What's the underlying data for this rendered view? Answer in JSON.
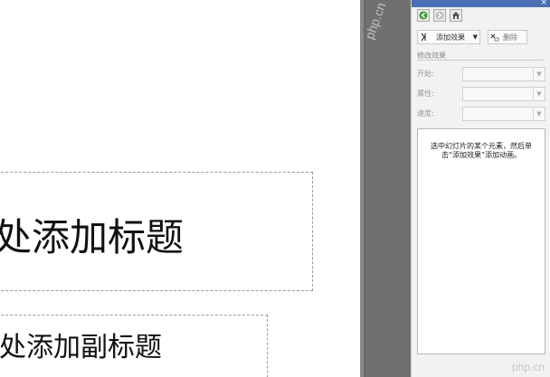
{
  "slide": {
    "title_placeholder": "处添加标题",
    "subtitle_placeholder": "处添加副标题"
  },
  "task_pane": {
    "toolbar": {
      "back_icon": "back-arrow-icon",
      "forward_icon": "forward-arrow-icon",
      "home_icon": "home-icon"
    },
    "add_effect_label": "添加效果",
    "remove_label": "删除",
    "modify_group_label": "修改效果",
    "fields": [
      {
        "label": "开始:"
      },
      {
        "label": "属性:"
      },
      {
        "label": "速度:"
      }
    ],
    "hint": "选中幻灯片的某个元素，然后单击“添加效果”添加动画。"
  },
  "watermark": {
    "vertical": "php.cn",
    "corner": "php.cn"
  },
  "colors": {
    "pane_title_bar": "#4a6fb4",
    "dark_divider": "#707070",
    "pane_background": "#f2f2f2"
  }
}
